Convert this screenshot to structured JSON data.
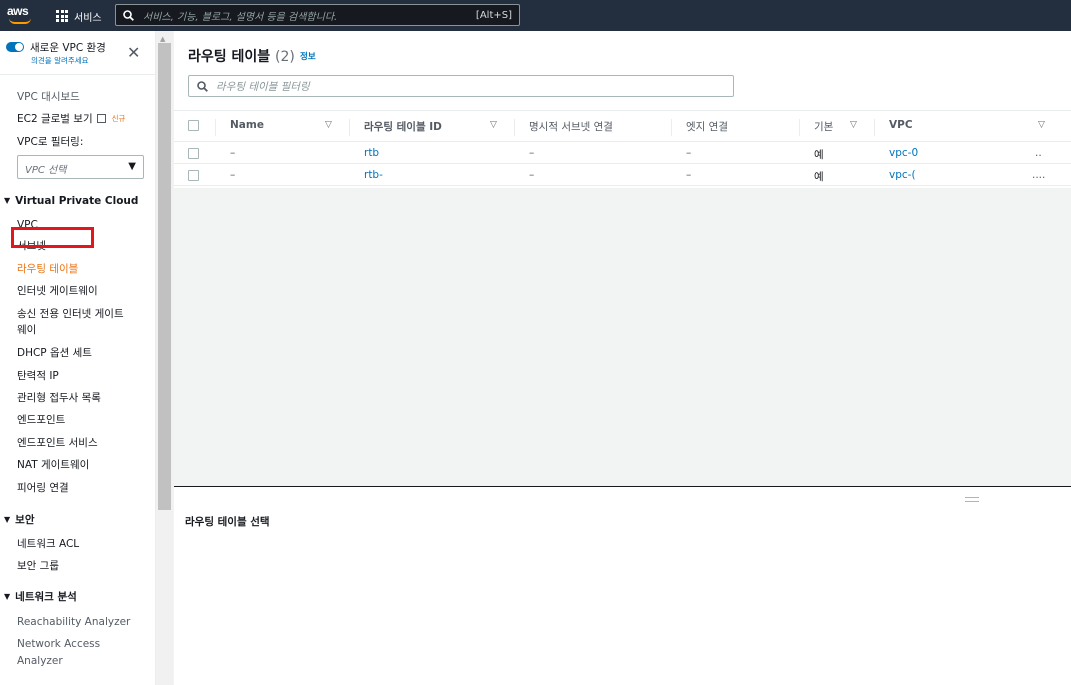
{
  "topbar": {
    "logo_text": "aws",
    "services_label": "서비스",
    "search_placeholder": "서비스, 기능, 블로그, 설명서 등을 검색합니다.",
    "search_shortcut": "[Alt+S]"
  },
  "sidebar": {
    "new_vpc_label": "새로운 VPC 환경",
    "feedback_link": "의견을 알려주세요",
    "dashboard": "VPC 대시보드",
    "ec2_global_view": "EC2 글로벌 보기",
    "new_badge": "신규",
    "filter_label": "VPC로 필터링:",
    "vpc_select_value": "VPC 선택",
    "sections": [
      {
        "title": "Virtual Private Cloud",
        "items": [
          "VPC",
          "서브넷",
          "라우팅 테이블",
          "인터넷 게이트웨이",
          "송신 전용 인터넷 게이트",
          "웨이",
          "DHCP 옵션 세트",
          "탄력적 IP",
          "관리형 접두사 목록",
          "엔드포인트",
          "엔드포인트 서비스",
          "NAT 게이트웨이",
          "피어링 연결"
        ]
      },
      {
        "title": "보안",
        "items": [
          "네트워크 ACL",
          "보안 그룹"
        ]
      },
      {
        "title": "네트워크 분석",
        "items": [
          "Reachability Analyzer",
          "Network Access",
          "Analyzer"
        ]
      }
    ]
  },
  "main": {
    "title": "라우팅 테이블",
    "count": "(2)",
    "info_link": "정보",
    "filter_placeholder": "라우팅 테이블 필터링",
    "columns": [
      "Name",
      "라우팅 테이블 ID",
      "명시적 서브넷 연결",
      "엣지 연결",
      "기본",
      "VPC"
    ],
    "rows": [
      {
        "name": "–",
        "id": "rtb",
        "subnet": "–",
        "edge": "–",
        "main": "예",
        "vpc": "vpc-0",
        "extra": ".."
      },
      {
        "name": "–",
        "id": "rtb-",
        "subnet": "–",
        "edge": "–",
        "main": "예",
        "vpc": "vpc-(",
        "extra": "...."
      }
    ],
    "detail_title": "라우팅 테이블 선택"
  },
  "colors": {
    "topbar": "#232f3e",
    "accent_link": "#0073bb",
    "active_nav": "#ec7211",
    "highlight_box": "#e2161d"
  }
}
